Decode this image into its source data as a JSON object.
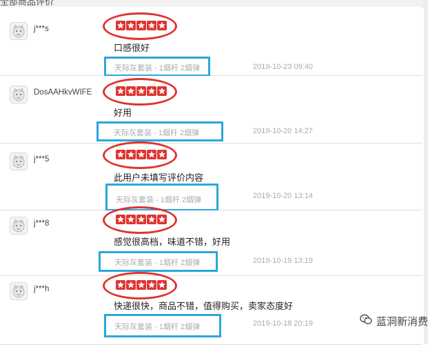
{
  "header": {
    "title": "全部商品评价"
  },
  "colors": {
    "star": "#e0332e",
    "highlight_red": "#e0332e",
    "highlight_blue": "#2aa7dc"
  },
  "reviews": [
    {
      "user": "j***s",
      "rating": 5,
      "comment": "口感很好",
      "product": "天际灰套装 - 1烟杆 2烟弹",
      "date": "2019-10-23 09:40"
    },
    {
      "user": "DosAAHkvWIFE",
      "rating": 5,
      "comment": "好用",
      "product": "天际灰套装 - 1烟杆 2烟弹",
      "date": "2019-10-20 14:27"
    },
    {
      "user": "j***5",
      "rating": 5,
      "comment": "此用户未填写评价内容",
      "product": "天际灰套装 - 1烟杆 2烟弹",
      "date": "2019-10-20 13:14"
    },
    {
      "user": "j***8",
      "rating": 5,
      "comment": "感觉很高档，味道不错，好用",
      "product": "天际灰套装 - 1烟杆 2烟弹",
      "date": "2019-10-19 13:19"
    },
    {
      "user": "j***h",
      "rating": 5,
      "comment": "快递很快，商品不错，值得购买，卖家态度好",
      "product": "天际灰套装 - 1烟杆 2烟弹",
      "date": "2019-10-18 20:19"
    }
  ],
  "watermark": {
    "text": "蓝洞新消费",
    "icon": "wechat-icon"
  }
}
